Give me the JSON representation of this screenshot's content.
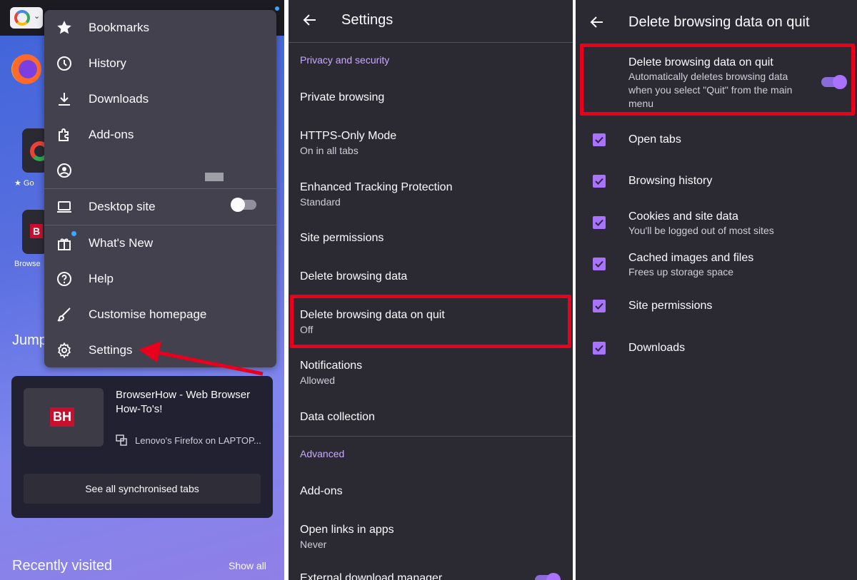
{
  "panel1": {
    "tiles": [
      "★ Go",
      "Browse"
    ],
    "jump_back": "Jump",
    "menu": {
      "items": [
        {
          "label": "Bookmarks",
          "icon": "star-icon"
        },
        {
          "label": "History",
          "icon": "clock-icon"
        },
        {
          "label": "Downloads",
          "icon": "download-icon"
        },
        {
          "label": "Add-ons",
          "icon": "puzzle-icon"
        },
        {
          "label": "",
          "icon": "account-icon"
        },
        {
          "label": "Desktop site",
          "icon": "laptop-icon"
        },
        {
          "label": "What's New",
          "icon": "gift-icon"
        },
        {
          "label": "Help",
          "icon": "help-icon"
        },
        {
          "label": "Customise homepage",
          "icon": "brush-icon"
        },
        {
          "label": "Settings",
          "icon": "gear-icon"
        }
      ],
      "desktop_site_enabled": false
    },
    "sync": {
      "thumb_text": "BH",
      "title": "BrowserHow - Web Browser How-To's!",
      "device": "Lenovo's Firefox on LAPTOP...",
      "button": "See all synchronised tabs"
    },
    "recently_visited": "Recently visited",
    "show_all": "Show all"
  },
  "panel2": {
    "title": "Settings",
    "section_privacy": "Privacy and security",
    "rows": [
      {
        "title": "Private browsing",
        "sub": ""
      },
      {
        "title": "HTTPS-Only Mode",
        "sub": "On in all tabs"
      },
      {
        "title": "Enhanced Tracking Protection",
        "sub": "Standard"
      },
      {
        "title": "Site permissions",
        "sub": ""
      },
      {
        "title": "Delete browsing data",
        "sub": ""
      },
      {
        "title": "Delete browsing data on quit",
        "sub": "Off"
      },
      {
        "title": "Notifications",
        "sub": "Allowed"
      },
      {
        "title": "Data collection",
        "sub": ""
      }
    ],
    "section_advanced": "Advanced",
    "adv_rows": [
      {
        "title": "Add-ons",
        "sub": ""
      },
      {
        "title": "Open links in apps",
        "sub": "Never"
      },
      {
        "title": "External download manager",
        "sub": ""
      }
    ]
  },
  "panel3": {
    "title": "Delete browsing data on quit",
    "main_toggle": {
      "title": "Delete browsing data on quit",
      "sub": "Automatically deletes browsing data when you select \"Quit\" from the main menu",
      "enabled": true
    },
    "options": [
      {
        "title": "Open tabs",
        "sub": "",
        "checked": true
      },
      {
        "title": "Browsing history",
        "sub": "",
        "checked": true
      },
      {
        "title": "Cookies and site data",
        "sub": "You'll be logged out of most sites",
        "checked": true
      },
      {
        "title": "Cached images and files",
        "sub": "Frees up storage space",
        "checked": true
      },
      {
        "title": "Site permissions",
        "sub": "",
        "checked": true
      },
      {
        "title": "Downloads",
        "sub": "",
        "checked": true
      }
    ]
  },
  "colors": {
    "accent": "#a972ff",
    "highlight": "#e8001c",
    "background": "#2b2a33",
    "menu": "#42414d"
  }
}
